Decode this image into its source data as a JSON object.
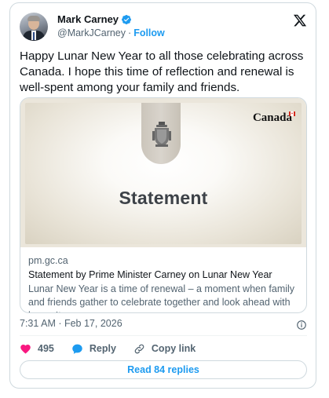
{
  "author": {
    "name": "Mark Carney",
    "handle": "@MarkJCarney",
    "separator": "·",
    "follow_label": "Follow"
  },
  "tweet": {
    "text": "Happy Lunar New Year to all those celebrating across Canada. I hope this time of reflection and renewal is well-spent among your family and friends."
  },
  "link_card": {
    "image_heading": "Statement",
    "brand_wordmark": "Canada",
    "domain": "pm.gc.ca",
    "title": "Statement by Prime Minister Carney on Lunar New Year",
    "description": "Lunar New Year is a time of renewal – a moment when family and friends gather to celebrate together and look ahead with hope. It ..."
  },
  "timestamp": "7:31 AM · Feb 17, 2026",
  "actions": {
    "like_count": "495",
    "reply_label": "Reply",
    "copy_link_label": "Copy link"
  },
  "read_replies_label": "Read 84 replies",
  "colors": {
    "accent": "#1d9bf0",
    "like": "#f91880",
    "muted_text": "#536471",
    "border": "#cfd9de"
  },
  "icons": [
    "verified-badge-icon",
    "x-logo-icon",
    "canada-crest-icon",
    "canada-flag-icon",
    "info-icon",
    "heart-icon",
    "reply-bubble-icon",
    "link-icon"
  ]
}
